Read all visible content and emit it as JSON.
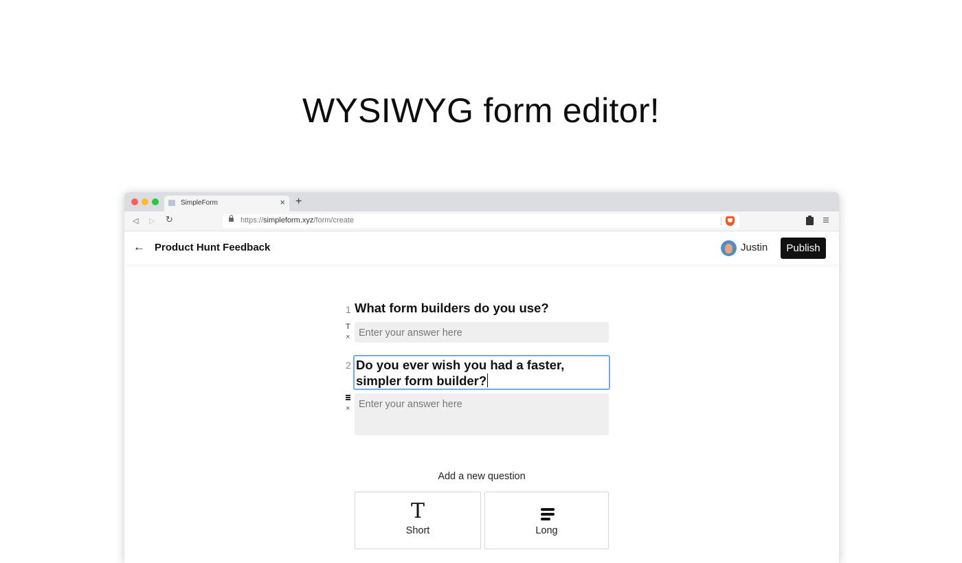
{
  "headline": "WYSIWYG form editor!",
  "browser": {
    "tab_title": "SimpleForm",
    "tab_close": "×",
    "new_tab": "+",
    "url_scheme": "https://",
    "url_domain": "simpleform.xyz",
    "url_path": "/form/create",
    "nav_back": "◁",
    "nav_forward": "▷",
    "nav_reload": "↻"
  },
  "appbar": {
    "back": "←",
    "form_name": "Product Hunt Feedback",
    "user_name": "Justin",
    "publish_label": "Publish"
  },
  "questions": [
    {
      "number": "1",
      "type_icon": "T",
      "delete": "×",
      "title": "What form builders do you use?",
      "placeholder": "Enter your answer here"
    },
    {
      "number": "2",
      "delete": "×",
      "title": "Do you ever wish you had a faster, simpler form builder?",
      "placeholder": "Enter your answer here"
    }
  ],
  "add_question": {
    "label": "Add a new question",
    "short_label": "Short",
    "short_icon": "T",
    "long_label": "Long"
  },
  "icons": {
    "short_type": "text-t-icon",
    "long_type": "long-text-lines-icon",
    "brave_shield": "brave-shield-icon",
    "clipboard": "clipboard-icon",
    "menu": "hamburger-menu-icon"
  },
  "colors": {
    "publish_bg": "#111111",
    "focus_border": "#77a7f2",
    "answer_bg": "#efefef"
  }
}
